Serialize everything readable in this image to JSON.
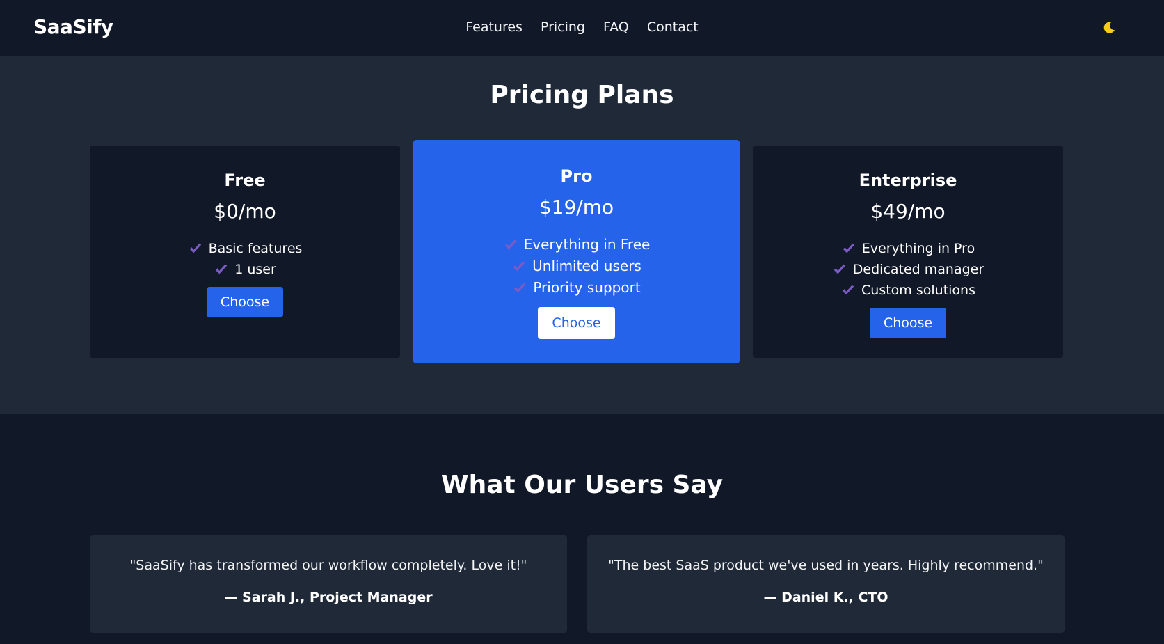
{
  "brand": "SaaSify",
  "nav": {
    "items": [
      "Features",
      "Pricing",
      "FAQ",
      "Contact"
    ]
  },
  "theme_toggle": {
    "icon": "moon-icon",
    "color": "#facc15"
  },
  "pricing": {
    "title": "Pricing Plans",
    "plans": [
      {
        "name": "Free",
        "price": "$0/mo",
        "features": [
          "Basic features",
          "1 user"
        ],
        "button": "Choose"
      },
      {
        "name": "Pro",
        "price": "$19/mo",
        "features": [
          "Everything in Free",
          "Unlimited users",
          "Priority support"
        ],
        "button": "Choose"
      },
      {
        "name": "Enterprise",
        "price": "$49/mo",
        "features": [
          "Everything in Pro",
          "Dedicated manager",
          "Custom solutions"
        ],
        "button": "Choose"
      }
    ]
  },
  "testimonials": {
    "title": "What Our Users Say",
    "items": [
      {
        "quote": "\"SaaSify has transformed our workflow completely. Love it!\"",
        "author": "— Sarah J., Project Manager"
      },
      {
        "quote": "\"The best SaaS product we've used in years. Highly recommend.\"",
        "author": "— Daniel K., CTO"
      }
    ]
  },
  "colors": {
    "accent": "#2563eb",
    "check": "#7c5cc4",
    "bg_dark": "#111827",
    "bg_section": "#1f2937"
  }
}
